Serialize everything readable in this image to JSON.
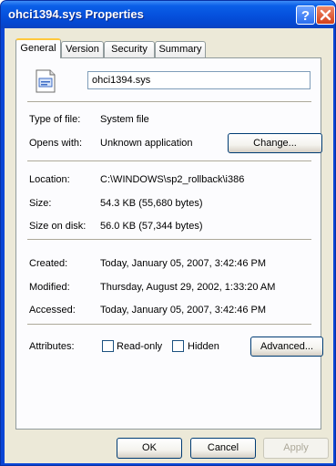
{
  "window": {
    "title": "ohci1394.sys Properties"
  },
  "tabs": [
    {
      "label": "General"
    },
    {
      "label": "Version"
    },
    {
      "label": "Security"
    },
    {
      "label": "Summary"
    }
  ],
  "general": {
    "file_name": "ohci1394.sys",
    "type_of_file": {
      "label": "Type of file:",
      "value": "System file"
    },
    "opens_with": {
      "label": "Opens with:",
      "value": "Unknown application",
      "button": "Change..."
    },
    "location": {
      "label": "Location:",
      "value": "C:\\WINDOWS\\sp2_rollback\\i386"
    },
    "size": {
      "label": "Size:",
      "value": "54.3 KB (55,680 bytes)"
    },
    "size_on_disk": {
      "label": "Size on disk:",
      "value": "56.0 KB (57,344 bytes)"
    },
    "created": {
      "label": "Created:",
      "value": "Today, January 05, 2007, 3:42:46 PM"
    },
    "modified": {
      "label": "Modified:",
      "value": "Thursday, August 29, 2002, 1:33:20 AM"
    },
    "accessed": {
      "label": "Accessed:",
      "value": "Today, January 05, 2007, 3:42:46 PM"
    },
    "attributes": {
      "label": "Attributes:",
      "read_only": "Read-only",
      "hidden": "Hidden",
      "advanced": "Advanced..."
    }
  },
  "buttons": {
    "ok": "OK",
    "cancel": "Cancel",
    "apply": "Apply"
  },
  "colors": {
    "titlebar": "#0550dc",
    "dialog_bg": "#ece9d8",
    "panel_bg": "#fcfcfe",
    "active_tab_accent": "#ffc83c"
  }
}
